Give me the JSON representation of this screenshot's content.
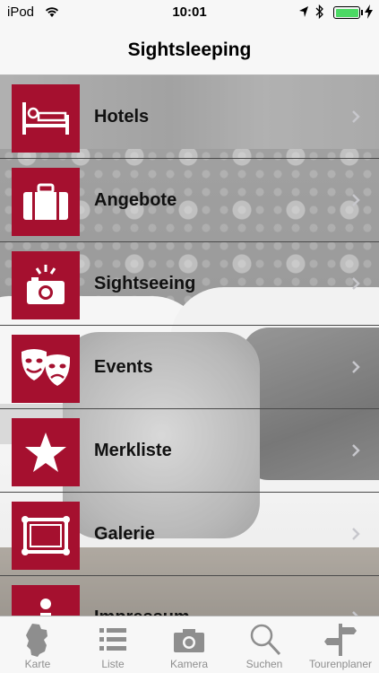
{
  "status_bar": {
    "carrier": "iPod",
    "time": "10:01"
  },
  "nav": {
    "title": "Sightsleeping"
  },
  "menu": {
    "items": [
      {
        "label": "Hotels",
        "icon": "bed-icon"
      },
      {
        "label": "Angebote",
        "icon": "suitcase-icon"
      },
      {
        "label": "Sightseeing",
        "icon": "camera-flash-icon"
      },
      {
        "label": "Events",
        "icon": "theater-masks-icon"
      },
      {
        "label": "Merkliste",
        "icon": "star-icon"
      },
      {
        "label": "Galerie",
        "icon": "picture-frame-icon"
      },
      {
        "label": "Impressum",
        "icon": "info-icon"
      }
    ],
    "tile_color": "#a5102f"
  },
  "tab_bar": {
    "tabs": [
      {
        "label": "Karte",
        "icon": "germany-map-icon",
        "active": true
      },
      {
        "label": "Liste",
        "icon": "list-icon",
        "active": false
      },
      {
        "label": "Kamera",
        "icon": "camera-icon",
        "active": false
      },
      {
        "label": "Suchen",
        "icon": "magnifier-icon",
        "active": false
      },
      {
        "label": "Tourenplaner",
        "icon": "signpost-icon",
        "active": false
      }
    ]
  }
}
